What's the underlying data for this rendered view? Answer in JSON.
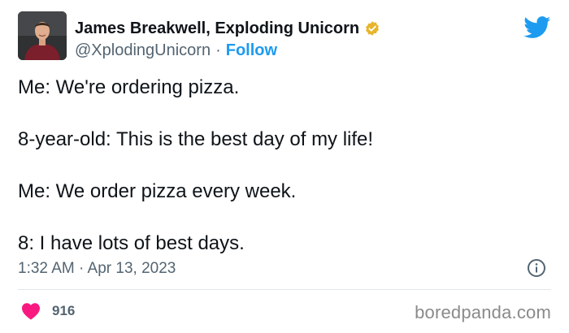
{
  "author": {
    "display_name": "James Breakwell, Exploding Unicorn",
    "handle": "@XplodingUnicorn",
    "separator": "·",
    "follow_label": "Follow",
    "verified_icon": "verified-badge-icon",
    "verified_color": "#f4c43e"
  },
  "brand": {
    "icon": "twitter-bird-icon",
    "color": "#1d9bf0"
  },
  "tweet": {
    "lines": [
      "Me: We're ordering pizza.",
      "8-year-old: This is the best day of my life!",
      "Me: We order pizza every week.",
      "8: I have lots of best days."
    ]
  },
  "meta": {
    "timestamp": "1:32 AM · Apr 13, 2023",
    "info_icon": "info-icon"
  },
  "engagement": {
    "like_icon": "heart-icon",
    "like_color": "#f91880",
    "like_count": "916"
  },
  "watermark": {
    "text": "boredpanda.com"
  }
}
